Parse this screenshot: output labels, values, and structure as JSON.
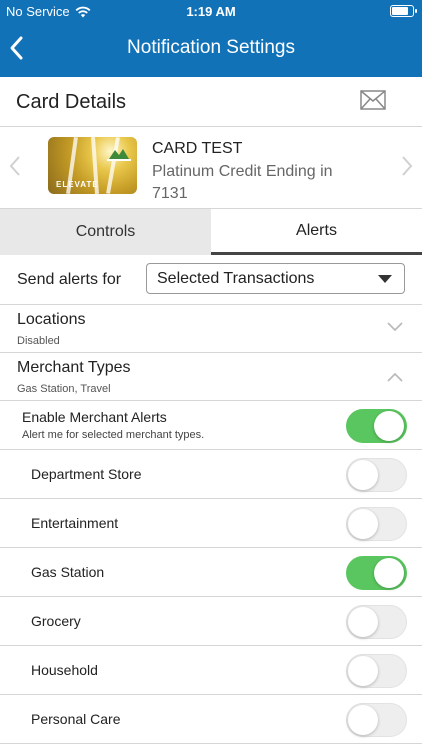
{
  "status_bar": {
    "carrier": "No Service",
    "time": "1:19 AM"
  },
  "nav": {
    "title": "Notification Settings"
  },
  "card_details": {
    "title": "Card Details"
  },
  "card": {
    "name": "CARD TEST",
    "description": "Platinum Credit Ending in 7131",
    "image_label": "ELEVATE"
  },
  "tabs": [
    {
      "label": "Controls",
      "selected": false
    },
    {
      "label": "Alerts",
      "selected": true
    }
  ],
  "send_alerts": {
    "label": "Send alerts for",
    "selected": "Selected Transactions"
  },
  "locations": {
    "title": "Locations",
    "subtitle": "Disabled"
  },
  "merchant_types": {
    "title": "Merchant Types",
    "subtitle": "Gas Station, Travel"
  },
  "enable_merchant": {
    "title": "Enable Merchant Alerts",
    "subtitle": "Alert me for selected merchant types.",
    "on": true
  },
  "merchants": [
    {
      "label": "Department Store",
      "on": false
    },
    {
      "label": "Entertainment",
      "on": false
    },
    {
      "label": "Gas Station",
      "on": true
    },
    {
      "label": "Grocery",
      "on": false
    },
    {
      "label": "Household",
      "on": false
    },
    {
      "label": "Personal Care",
      "on": false
    }
  ],
  "colors": {
    "header": "#1272b8",
    "toggle_on": "#5ac65f",
    "toggle_off": "#eeeeee"
  }
}
